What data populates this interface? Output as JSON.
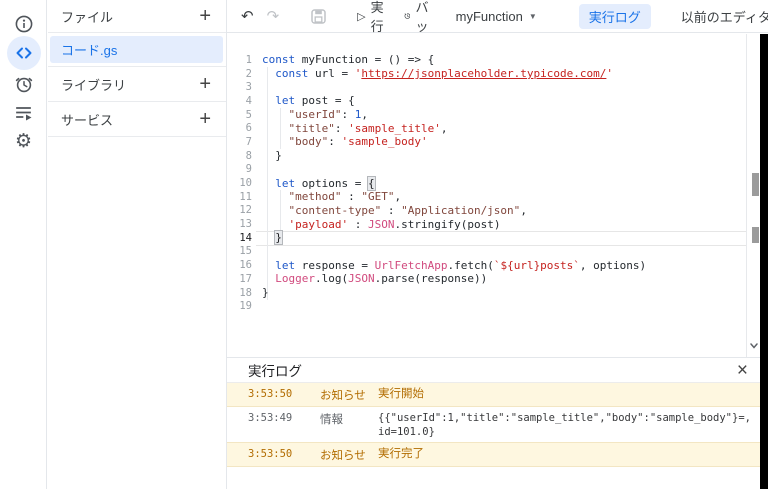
{
  "rail": {
    "icons": [
      {
        "name": "info-icon"
      },
      {
        "name": "editor-code-icon",
        "selected": true
      },
      {
        "name": "triggers-clock-icon"
      },
      {
        "name": "executions-list-icon"
      },
      {
        "name": "settings-gear-icon",
        "glyph": "⚙"
      }
    ]
  },
  "file_panel": {
    "files_header": "ファイル",
    "add_label": "+",
    "files": [
      {
        "name": "コード.gs",
        "selected": true
      }
    ],
    "libraries_header": "ライブラリ",
    "services_header": "サービス"
  },
  "toolbar": {
    "undo_glyph": "↶",
    "redo_glyph": "↷",
    "run_glyph": "▷",
    "run_label": "実行",
    "debug_label": "デバッグ",
    "function_selector": "myFunction",
    "function_caret": "▼",
    "log_button_label": "実行ログ",
    "legacy_label": "以前のエディタを使用"
  },
  "editor": {
    "active_line": 14,
    "lines": [
      {
        "n": 1,
        "s": [
          [
            "kw",
            "const"
          ],
          [
            "pl",
            " myFunction = () => {"
          ]
        ]
      },
      {
        "n": 2,
        "s": [
          [
            "pl",
            "  "
          ],
          [
            "kw",
            "const"
          ],
          [
            "pl",
            " url = "
          ],
          [
            "str",
            "'"
          ],
          [
            "url",
            "https://jsonplaceholder.typicode.com/"
          ],
          [
            "str",
            "'"
          ]
        ]
      },
      {
        "n": 3,
        "s": []
      },
      {
        "n": 4,
        "s": [
          [
            "pl",
            "  "
          ],
          [
            "kw",
            "let"
          ],
          [
            "pl",
            " post = {"
          ]
        ]
      },
      {
        "n": 5,
        "s": [
          [
            "pl",
            "    "
          ],
          [
            "strq",
            "\"userId\""
          ],
          [
            "pl",
            ": "
          ],
          [
            "num",
            "1"
          ],
          [
            "pl",
            ","
          ]
        ]
      },
      {
        "n": 6,
        "s": [
          [
            "pl",
            "    "
          ],
          [
            "strq",
            "\"title\""
          ],
          [
            "pl",
            ": "
          ],
          [
            "str",
            "'sample_title'"
          ],
          [
            "pl",
            ","
          ]
        ]
      },
      {
        "n": 7,
        "s": [
          [
            "pl",
            "    "
          ],
          [
            "strq",
            "\"body\""
          ],
          [
            "pl",
            ": "
          ],
          [
            "str",
            "'sample_body'"
          ]
        ]
      },
      {
        "n": 8,
        "s": [
          [
            "pl",
            "  }"
          ]
        ]
      },
      {
        "n": 9,
        "s": []
      },
      {
        "n": 10,
        "s": [
          [
            "pl",
            "  "
          ],
          [
            "kw",
            "let"
          ],
          [
            "pl",
            " options = "
          ],
          [
            "brk",
            "{"
          ]
        ]
      },
      {
        "n": 11,
        "s": [
          [
            "pl",
            "    "
          ],
          [
            "strq",
            "\"method\""
          ],
          [
            "pl",
            " : "
          ],
          [
            "strq",
            "\"GET\""
          ],
          [
            "pl",
            ","
          ]
        ]
      },
      {
        "n": 12,
        "s": [
          [
            "pl",
            "    "
          ],
          [
            "strq",
            "\"content-type\""
          ],
          [
            "pl",
            " : "
          ],
          [
            "strq",
            "\"Application/json\""
          ],
          [
            "pl",
            ","
          ]
        ]
      },
      {
        "n": 13,
        "s": [
          [
            "pl",
            "    "
          ],
          [
            "str",
            "'payload'"
          ],
          [
            "pl",
            " : "
          ],
          [
            "bi",
            "JSON"
          ],
          [
            "pl",
            ".stringify(post)"
          ]
        ]
      },
      {
        "n": 14,
        "s": [
          [
            "pl",
            "  "
          ],
          [
            "brk",
            "}"
          ],
          [
            "cur",
            ""
          ]
        ]
      },
      {
        "n": 15,
        "s": []
      },
      {
        "n": 16,
        "s": [
          [
            "pl",
            "  "
          ],
          [
            "kw",
            "let"
          ],
          [
            "pl",
            " response = "
          ],
          [
            "bi",
            "UrlFetchApp"
          ],
          [
            "pl",
            ".fetch("
          ],
          [
            "str",
            "`${url}posts`"
          ],
          [
            "pl",
            ", options)"
          ]
        ]
      },
      {
        "n": 17,
        "s": [
          [
            "pl",
            "  "
          ],
          [
            "bi",
            "Logger"
          ],
          [
            "pl",
            ".log("
          ],
          [
            "bi",
            "JSON"
          ],
          [
            "pl",
            ".parse(response))"
          ]
        ]
      },
      {
        "n": 18,
        "s": [
          [
            "pl",
            "}"
          ]
        ]
      },
      {
        "n": 19,
        "s": []
      }
    ]
  },
  "log_panel": {
    "title": "実行ログ",
    "close_glyph": "×",
    "rows": [
      {
        "kind": "notice",
        "time": "3:53:50",
        "label": "お知らせ",
        "message_lines": [
          "実行開始"
        ]
      },
      {
        "kind": "info",
        "time": "3:53:49",
        "label": "情報",
        "message_lines": [
          "{{\"userId\":1,\"title\":\"sample_title\",\"body\":\"sample_body\"}=,",
          "id=101.0}"
        ]
      },
      {
        "kind": "notice",
        "time": "3:53:50",
        "label": "お知らせ",
        "message_lines": [
          "実行完了"
        ]
      }
    ]
  },
  "colors": {
    "accent_blue": "#1a73e8",
    "selection_bg": "#e4edfd",
    "log_notice_bg": "#fef7e0",
    "log_notice_text": "#b26c00",
    "keyword": "#1e57c8",
    "string": "#c5221f",
    "builtin": "#d14a7e"
  }
}
